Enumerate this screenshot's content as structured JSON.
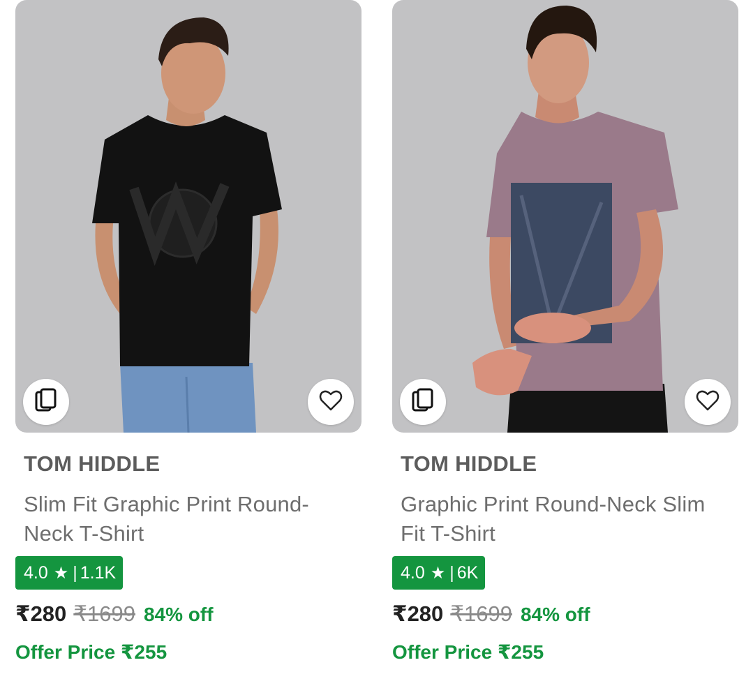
{
  "products": [
    {
      "brand": "TOM HIDDLE",
      "title": "Slim Fit Graphic Print Round-Neck T-Shirt",
      "rating": "4.0",
      "rating_count": "1.1K",
      "price": "₹280",
      "mrp": "₹1699",
      "discount": "84% off",
      "offer_price": "Offer Price ₹255",
      "shirt_color": "#121212"
    },
    {
      "brand": "TOM HIDDLE",
      "title": "Graphic Print Round-Neck Slim Fit T-Shirt",
      "rating": "4.0",
      "rating_count": "6K",
      "price": "₹280",
      "mrp": "₹1699",
      "discount": "84% off",
      "offer_price": "Offer Price ₹255",
      "shirt_color": "#9a7a8a"
    }
  ],
  "rating_star_icon": "star-icon",
  "compare_icon": "cards-icon",
  "wishlist_icon": "heart-icon",
  "colors": {
    "rating_badge": "#14953f",
    "discount": "#14953f",
    "image_bg": "#c2c2c4"
  }
}
